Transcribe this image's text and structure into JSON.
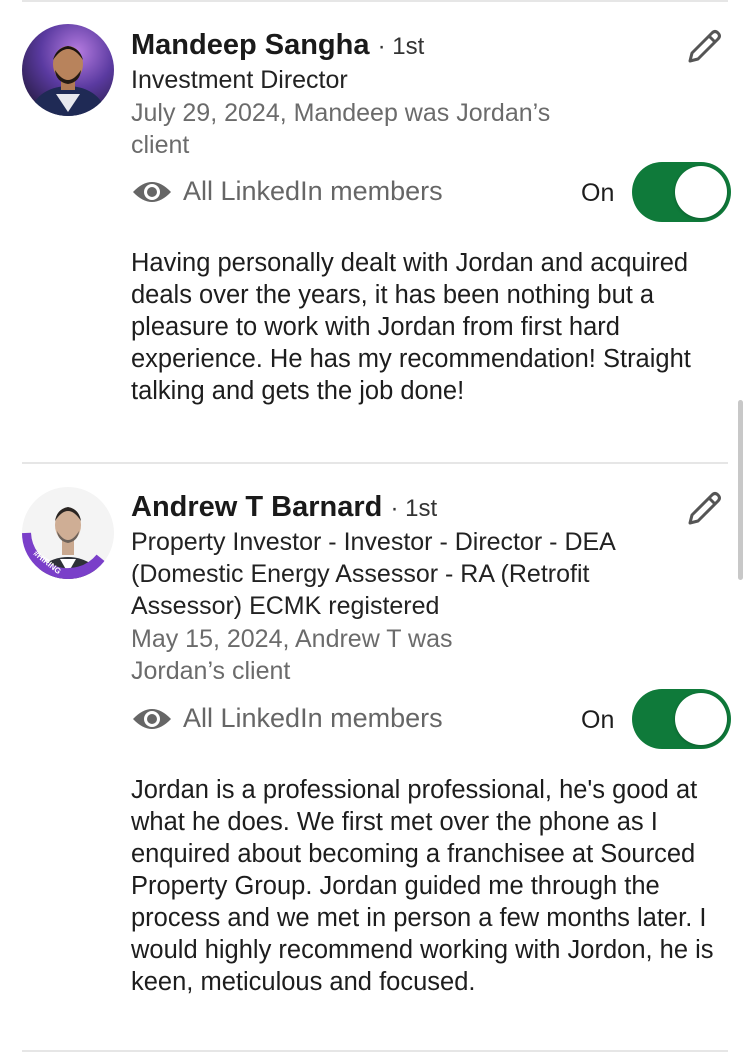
{
  "recommendations": [
    {
      "name": "Mandeep Sangha",
      "degree": "· 1st",
      "headline": "Investment Director",
      "meta": "July 29, 2024, Mandeep was Jordan’s client",
      "visibility": "All LinkedIn members",
      "toggle_label": "On",
      "toggle_on": true,
      "text": "Having personally dealt with Jordan and acquired deals over the years, it has been nothing but a pleasure to work with Jordan from first hard experience. He has my recommendation! Straight talking and gets the job done!"
    },
    {
      "name": "Andrew T Barnard",
      "degree": "· 1st",
      "headline": "Property Investor - Investor - Director - DEA (Domestic Energy Assessor - RA (Retrofit Assessor) ECMK registered",
      "meta": "May 15, 2024, Andrew T was Jordan’s client",
      "visibility": "All LinkedIn members",
      "toggle_label": "On",
      "toggle_on": true,
      "badge": "#HIRING",
      "text": "Jordan is a professional professional, he's good at what he does. We first met over the phone as I enquired about becoming a franchisee at Sourced Property Group. Jordan guided me through the process and we met in person a few months later. I would highly recommend working with Jordon, he is keen, meticulous and focused."
    }
  ],
  "colors": {
    "toggle_on": "#0f7a3a",
    "hiring_ring": "#7a3fc9",
    "muted_text": "#6b6b6b"
  }
}
